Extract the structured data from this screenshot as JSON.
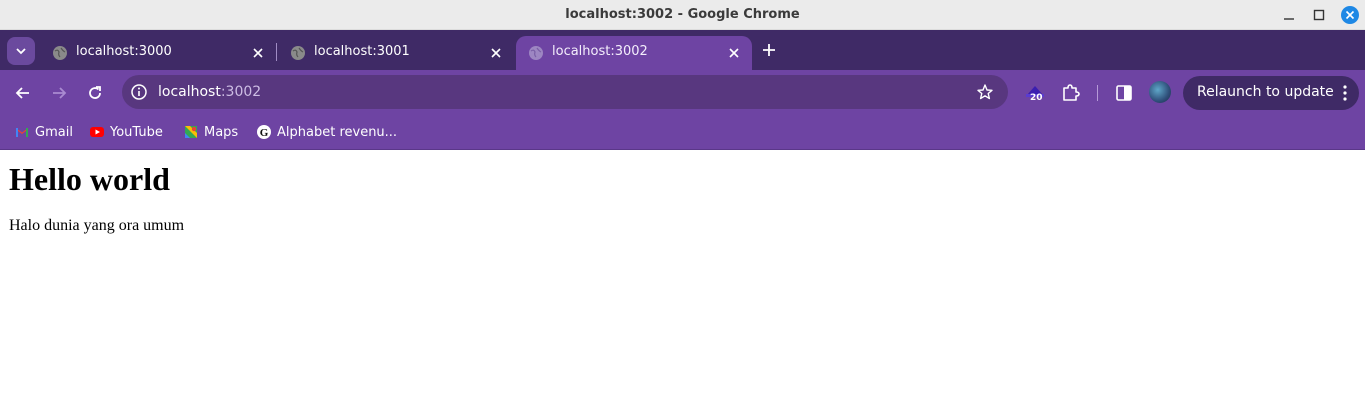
{
  "window": {
    "title": "localhost:3002 - Google Chrome"
  },
  "tabs": [
    {
      "label": "localhost:3000",
      "active": false
    },
    {
      "label": "localhost:3001",
      "active": false
    },
    {
      "label": "localhost:3002",
      "active": true
    }
  ],
  "omnibox": {
    "host": "localhost",
    "port": ":3002"
  },
  "extension_badge": "20",
  "relaunch_label": "Relaunch to update",
  "bookmarks": [
    {
      "label": "Gmail",
      "icon": "gmail-icon"
    },
    {
      "label": "YouTube",
      "icon": "youtube-icon"
    },
    {
      "label": "Maps",
      "icon": "maps-icon"
    },
    {
      "label": "Alphabet revenu...",
      "icon": "alphabet-icon"
    }
  ],
  "page": {
    "heading": "Hello world",
    "paragraph": "Halo dunia yang ora umum"
  },
  "colors": {
    "tabstrip": "#3f2a66",
    "toolbar": "#6e44a3",
    "omnibox": "#58377f",
    "close_button": "#1e88e5"
  }
}
